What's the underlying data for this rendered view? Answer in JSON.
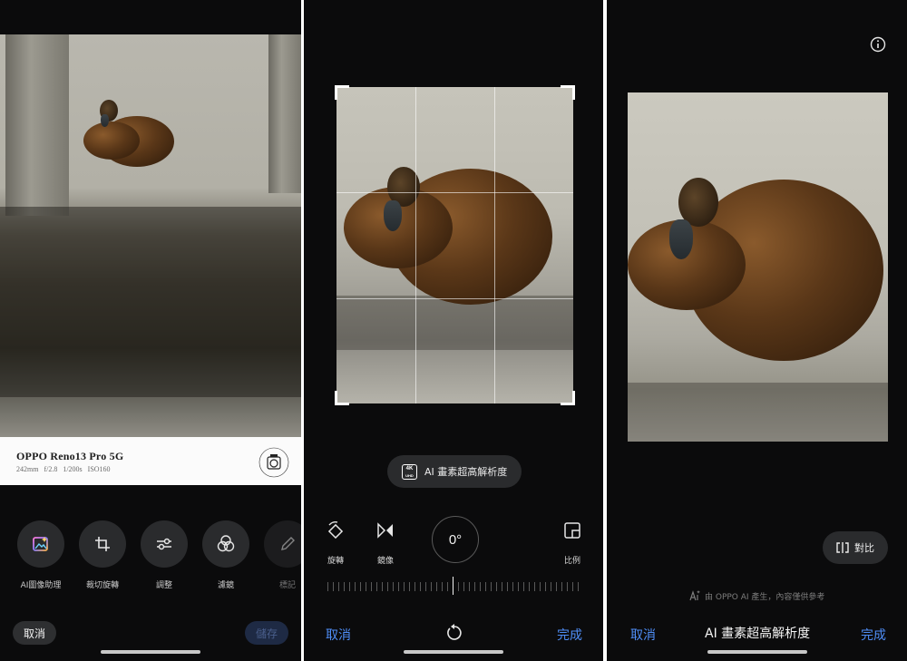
{
  "panel1": {
    "caption": {
      "model": "OPPO Reno13 Pro 5G",
      "specs": "242mm  f/2.8  1/200s  ISO160"
    },
    "tools": [
      {
        "label": "AI圖像助理",
        "icon": "ai-sparkle-image-icon"
      },
      {
        "label": "裁切旋轉",
        "icon": "crop-rotate-icon"
      },
      {
        "label": "調整",
        "icon": "sliders-icon"
      },
      {
        "label": "濾鏡",
        "icon": "filter-circles-icon"
      },
      {
        "label": "標記",
        "icon": "pen-icon"
      }
    ],
    "cancel_label": "取消",
    "save_label": "儲存"
  },
  "panel2": {
    "ai_chip": {
      "badge_top": "4K",
      "badge_bottom": "UHD",
      "label": "AI 畫素超高解析度"
    },
    "controls": {
      "rotate": "旋轉",
      "mirror": "鏡像",
      "ratio": "比例"
    },
    "dial_value": "0°",
    "cancel_label": "取消",
    "done_label": "完成"
  },
  "panel3": {
    "compare_label": "對比",
    "disclaimer": "由 OPPO AI 產生，內容僅供參考",
    "title": "AI 畫素超高解析度",
    "cancel_label": "取消",
    "done_label": "完成"
  },
  "colors": {
    "accent_blue": "#4f8ef7",
    "background": "#0b0b0c",
    "chip": "#2a2b2d"
  }
}
